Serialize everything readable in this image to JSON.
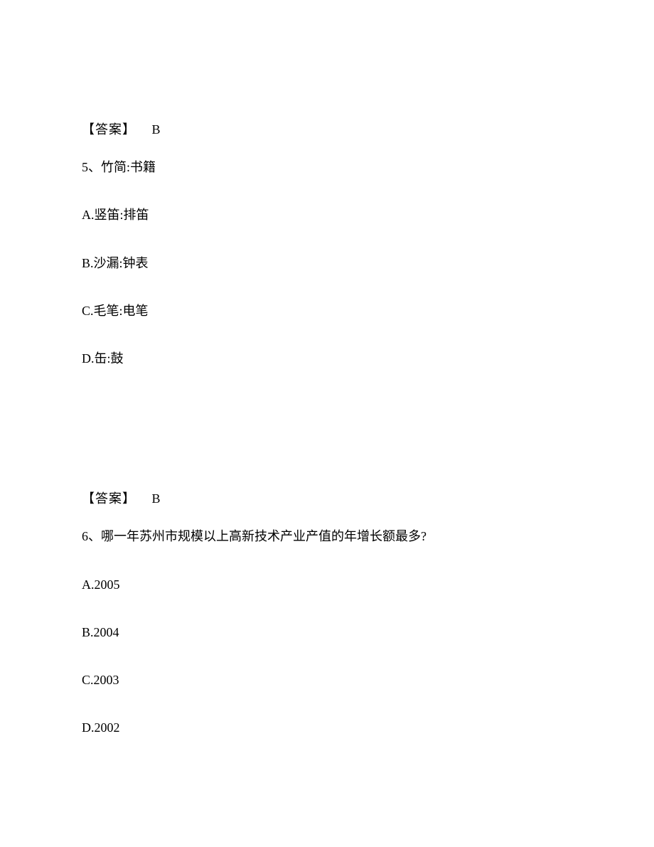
{
  "q5": {
    "prev_answer_label": "【答案】",
    "prev_answer_value": "B",
    "stem": "5、竹简:书籍",
    "options": {
      "a": "A.竖笛:排笛",
      "b": "B.沙漏:钟表",
      "c": "C.毛笔:电笔",
      "d": "D.缶:鼓"
    },
    "answer_label": "【答案】",
    "answer_value": "B"
  },
  "q6": {
    "stem": "6、哪一年苏州市规模以上高新技术产业产值的年增长额最多?",
    "options": {
      "a": "A.2005",
      "b": "B.2004",
      "c": "C.2003",
      "d": "D.2002"
    }
  }
}
